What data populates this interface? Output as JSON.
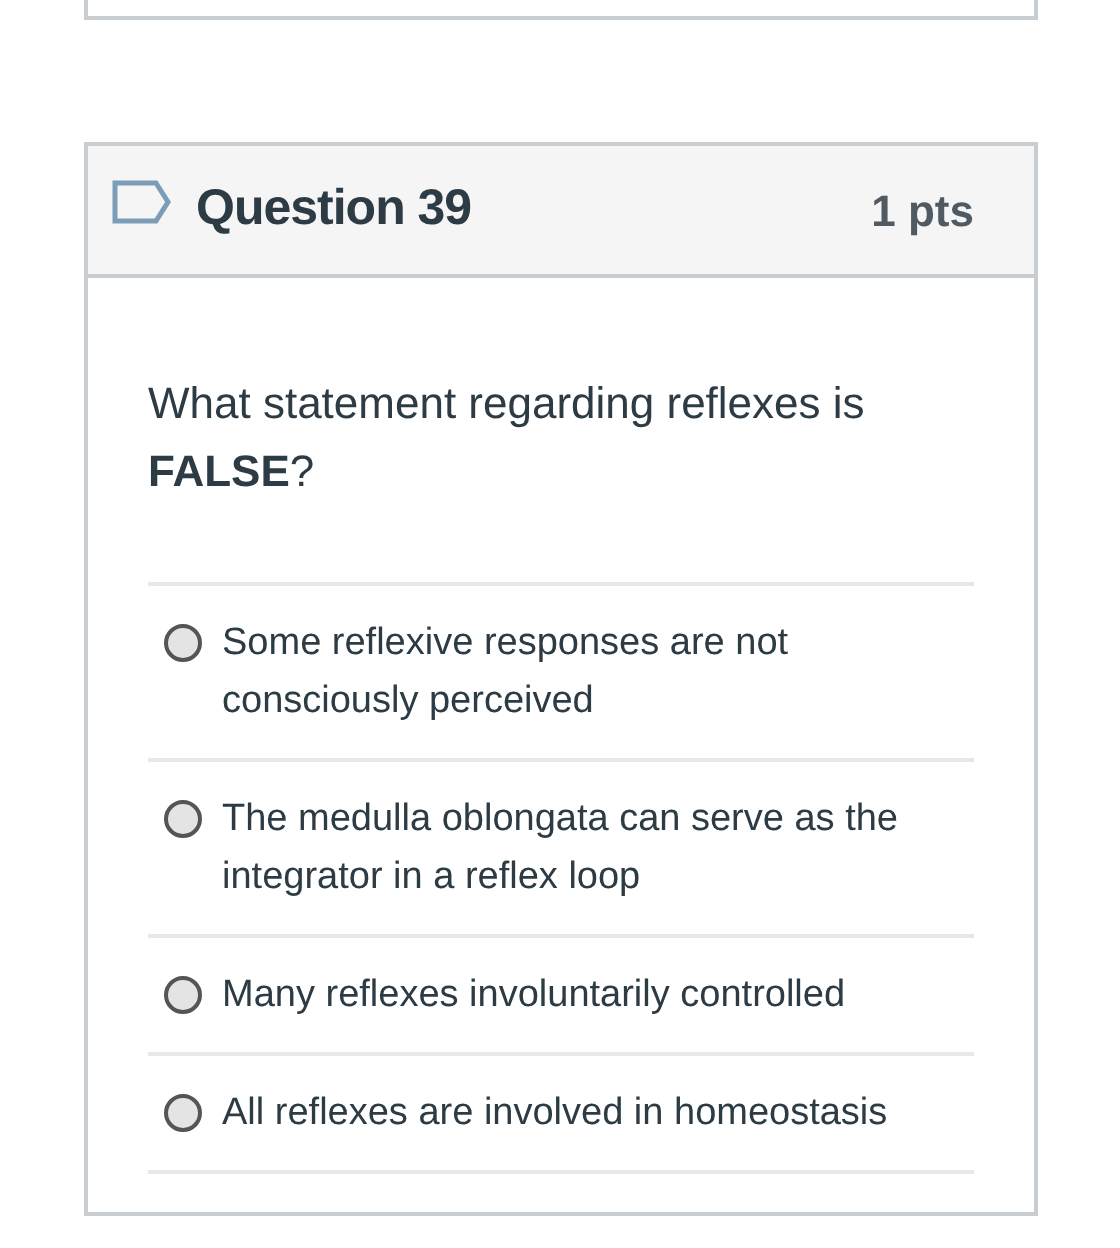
{
  "question": {
    "title": "Question 39",
    "points": "1 pts",
    "flagged": false,
    "prompt": "What statement regarding reflexes is **FALSE**?",
    "answers": [
      {
        "text": "Some reflexive responses are not consciously perceived",
        "selected": false
      },
      {
        "text": "The medulla oblongata can serve as the integrator in a reflex loop",
        "selected": false
      },
      {
        "text": "Many reflexes involuntarily controlled",
        "selected": false
      },
      {
        "text": "All reflexes are involved in homeostasis",
        "selected": false
      }
    ]
  }
}
